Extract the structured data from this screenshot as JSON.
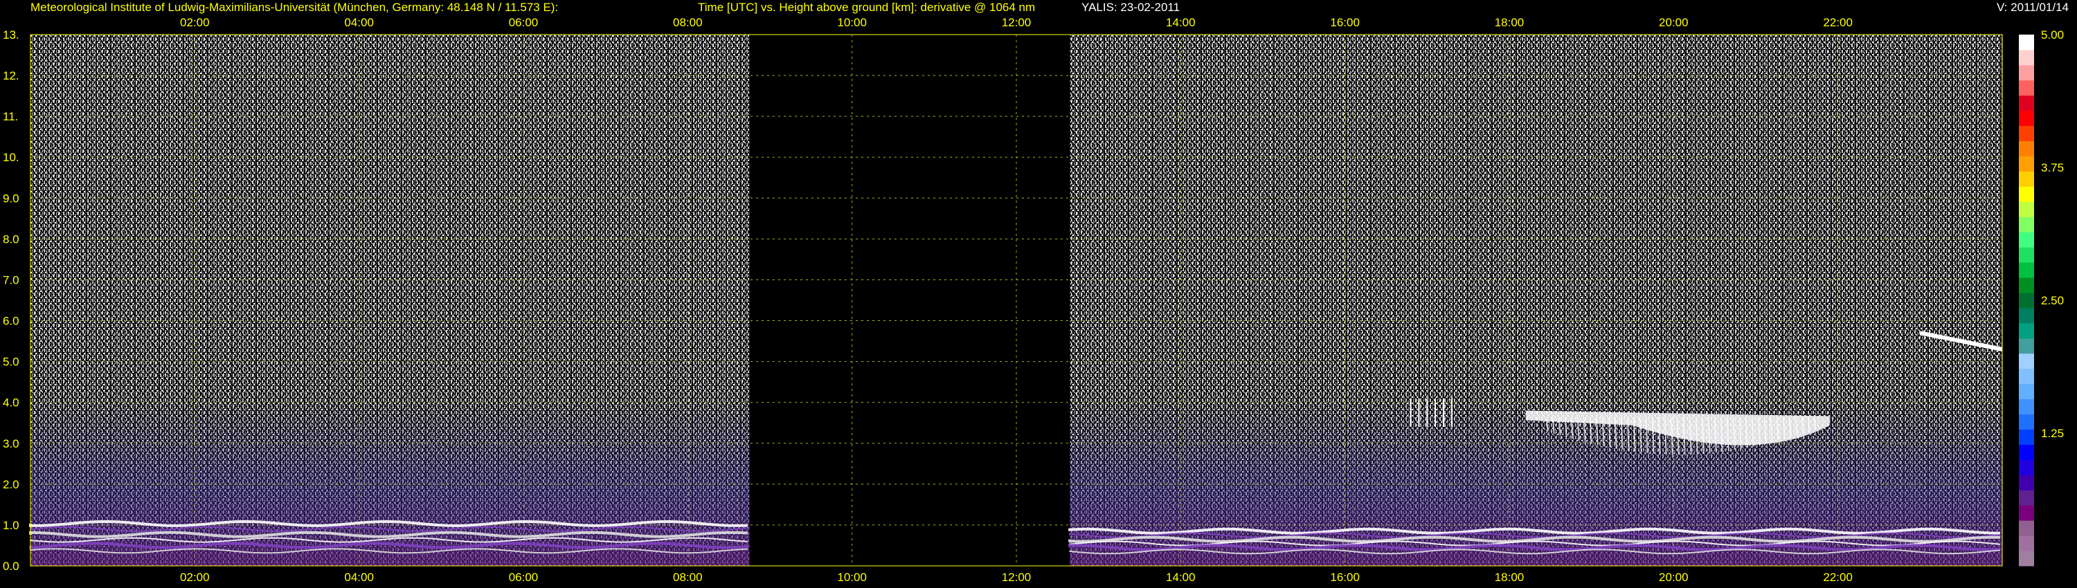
{
  "header": {
    "institute": "Meteorological Institute of Ludwig-Maximilians-Universität (München, Germany: 48.148 N / 11.573 E):",
    "plot_description": "Time [UTC] vs. Height above ground [km]: derivative @ 1064 nm",
    "site": "YALIS: 23-02-2011",
    "version": "V: 2011/01/14"
  },
  "colors": {
    "background": "#000000",
    "text": "#ffff00",
    "grid": "#b0b020",
    "data_gap": "#000000"
  },
  "chart_data": {
    "type": "heatmap",
    "title": "Time [UTC] vs. Height above ground [km]: derivative @ 1064 nm",
    "xlabel": "Time [UTC]",
    "ylabel": "Height above ground [km]",
    "x_range_hours": [
      0.0,
      24.0
    ],
    "y_range_km": [
      0.0,
      13.0
    ],
    "x_ticks": [
      "02:00",
      "04:00",
      "06:00",
      "08:00",
      "10:00",
      "12:00",
      "14:00",
      "16:00",
      "18:00",
      "20:00",
      "22:00"
    ],
    "x_tick_values": [
      2,
      4,
      6,
      8,
      10,
      12,
      14,
      16,
      18,
      20,
      22
    ],
    "y_ticks": [
      "0.0",
      "1.0",
      "2.0",
      "3.0",
      "4.0",
      "5.0",
      "6.0",
      "7.0",
      "8.0",
      "9.0",
      "10.",
      "11.",
      "12.",
      "13."
    ],
    "y_tick_values": [
      0,
      1,
      2,
      3,
      4,
      5,
      6,
      7,
      8,
      9,
      10,
      11,
      12,
      13
    ],
    "grid": true,
    "data_gap_hours": [
      8.75,
      12.65
    ],
    "colorbar": {
      "placement": "right",
      "ticks": [
        "1.25",
        "2.50",
        "3.75",
        "5.00"
      ],
      "tick_values": [
        1.25,
        2.5,
        3.75,
        5.0
      ],
      "range": [
        0.0,
        5.0
      ],
      "colors": [
        "#a080a0",
        "#a070a0",
        "#906090",
        "#7a0080",
        "#602090",
        "#4000b0",
        "#2000e0",
        "#0000ff",
        "#0040ff",
        "#2070ff",
        "#4090ff",
        "#60b0ff",
        "#80c0ff",
        "#a0d0ff",
        "#40a0a0",
        "#00a080",
        "#008060",
        "#007030",
        "#009020",
        "#00c040",
        "#20e060",
        "#40ff80",
        "#80ff60",
        "#c0ff40",
        "#ffff00",
        "#ffd000",
        "#ffa000",
        "#ff8000",
        "#ff4000",
        "#ff0000",
        "#e00020",
        "#ff6060",
        "#ffa0a0",
        "#ffd0d0",
        "#ffffff"
      ]
    },
    "features": [
      {
        "name": "boundary layer (morning)",
        "t_start": 0.0,
        "t_end": 8.75,
        "height_km": [
          0.3,
          1.1
        ]
      },
      {
        "name": "boundary layer (afternoon)",
        "t_start": 12.65,
        "t_end": 24.0,
        "height_km": [
          0.3,
          0.9
        ]
      },
      {
        "name": "cloud layer",
        "t_start": 18.2,
        "t_end": 21.9,
        "height_km": [
          2.6,
          3.8
        ]
      },
      {
        "name": "small cloud",
        "t_start": 16.8,
        "t_end": 17.3,
        "height_km": [
          3.4,
          4.1
        ]
      },
      {
        "name": "upper cloud",
        "t_start": 23.0,
        "t_end": 24.0,
        "height_km": [
          5.3,
          5.7
        ]
      }
    ]
  }
}
